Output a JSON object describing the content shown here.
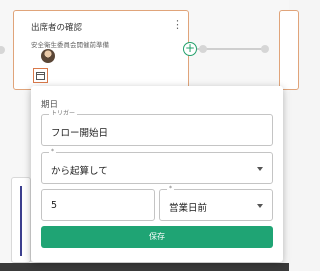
{
  "card": {
    "title": "出席者の確認",
    "subtitle": "安全衛生委員会開催前準備",
    "menu_icon": "more-vert-icon",
    "calendar_icon": "calendar-icon"
  },
  "popup": {
    "heading": "期日",
    "trigger": {
      "legend": "トリガー",
      "value": "フロー開始日"
    },
    "basis": {
      "legend": "*",
      "value": "から起算して"
    },
    "offset": {
      "value": "5"
    },
    "unit": {
      "legend": "*",
      "value": "営業日前"
    },
    "save_label": "保存"
  },
  "colors": {
    "accent": "#1fa474",
    "card_border": "#e0a47a",
    "highlight": "#d9794a"
  }
}
